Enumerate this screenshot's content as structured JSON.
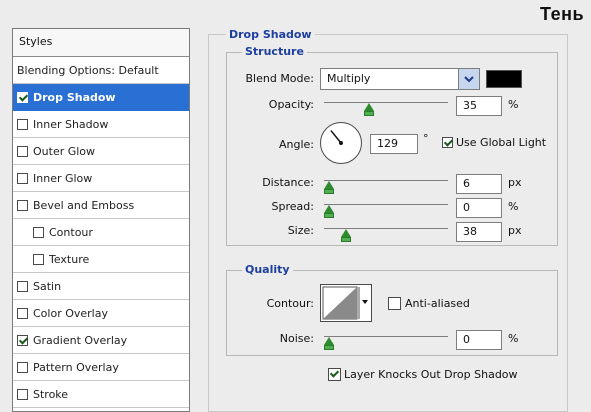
{
  "window": {
    "title": "Тень"
  },
  "styles_panel": {
    "header": "Styles",
    "items": [
      {
        "label": "Blending Options: Default",
        "checkbox": false,
        "checked": false,
        "selected": false,
        "indent": false
      },
      {
        "label": "Drop Shadow",
        "checkbox": true,
        "checked": true,
        "selected": true,
        "indent": false
      },
      {
        "label": "Inner Shadow",
        "checkbox": true,
        "checked": false,
        "selected": false,
        "indent": false
      },
      {
        "label": "Outer Glow",
        "checkbox": true,
        "checked": false,
        "selected": false,
        "indent": false
      },
      {
        "label": "Inner Glow",
        "checkbox": true,
        "checked": false,
        "selected": false,
        "indent": false
      },
      {
        "label": "Bevel and Emboss",
        "checkbox": true,
        "checked": false,
        "selected": false,
        "indent": false
      },
      {
        "label": "Contour",
        "checkbox": true,
        "checked": false,
        "selected": false,
        "indent": true
      },
      {
        "label": "Texture",
        "checkbox": true,
        "checked": false,
        "selected": false,
        "indent": true
      },
      {
        "label": "Satin",
        "checkbox": true,
        "checked": false,
        "selected": false,
        "indent": false
      },
      {
        "label": "Color Overlay",
        "checkbox": true,
        "checked": false,
        "selected": false,
        "indent": false
      },
      {
        "label": "Gradient Overlay",
        "checkbox": true,
        "checked": true,
        "selected": false,
        "indent": false
      },
      {
        "label": "Pattern Overlay",
        "checkbox": true,
        "checked": false,
        "selected": false,
        "indent": false
      },
      {
        "label": "Stroke",
        "checkbox": true,
        "checked": false,
        "selected": false,
        "indent": false
      }
    ]
  },
  "drop_shadow": {
    "title": "Drop Shadow",
    "structure": {
      "title": "Structure",
      "blend_mode": {
        "label": "Blend Mode:",
        "value": "Multiply",
        "color": "#000000"
      },
      "opacity": {
        "label": "Opacity:",
        "value": "35",
        "unit": "%",
        "level": 0.35
      },
      "angle": {
        "label": "Angle:",
        "value": "129",
        "unit": "°",
        "degrees": 129,
        "use_global_light_label": "Use Global Light",
        "use_global_light": true
      },
      "distance": {
        "label": "Distance:",
        "value": "6",
        "unit": "px",
        "level": 0.0
      },
      "spread": {
        "label": "Spread:",
        "value": "0",
        "unit": "%",
        "level": 0.0
      },
      "size": {
        "label": "Size:",
        "value": "38",
        "unit": "px",
        "level": 0.15
      }
    },
    "quality": {
      "title": "Quality",
      "contour": {
        "label": "Contour:",
        "anti_aliased_label": "Anti-aliased",
        "anti_aliased": false
      },
      "noise": {
        "label": "Noise:",
        "value": "0",
        "unit": "%",
        "level": 0.0
      }
    },
    "layer_knocks_out": {
      "label": "Layer Knocks Out Drop Shadow",
      "checked": true
    }
  },
  "colors": {
    "accent": "#2a6fd4",
    "legend_text": "#1d3f9e",
    "slider_thumb": "#4fb04f"
  }
}
